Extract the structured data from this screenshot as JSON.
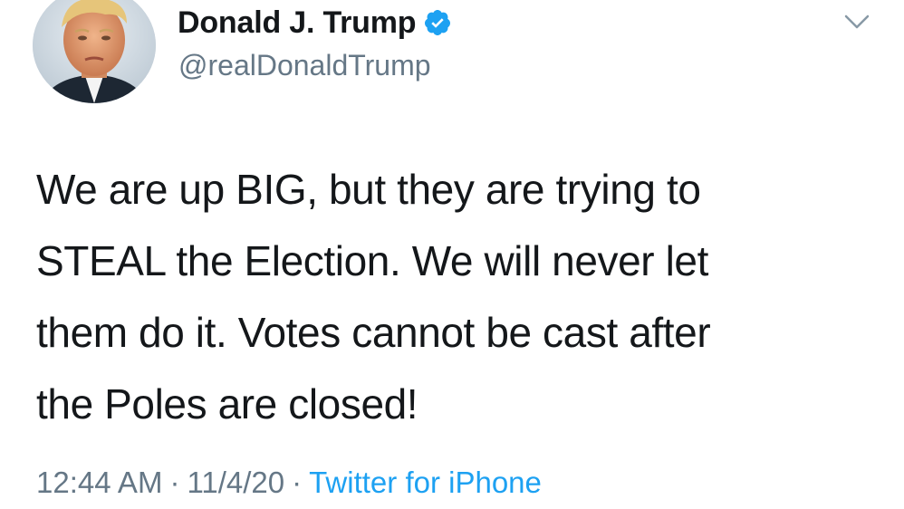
{
  "tweet": {
    "author": {
      "display_name": "Donald J. Trump",
      "handle": "@realDonaldTrump",
      "verified_icon": "verified-badge-icon",
      "avatar_icon": "profile-photo"
    },
    "menu_icon": "chevron-down-icon",
    "text_lines": [
      "We are up BIG, but they are trying to",
      "STEAL the Election. We will never let",
      "them do it. Votes cannot be cast after",
      "the Poles are closed!"
    ],
    "time": "12:44 AM",
    "separator": "·",
    "date": "11/4/20",
    "source": "Twitter for iPhone"
  },
  "colors": {
    "text": "#14171a",
    "secondary_text": "#657786",
    "accent": "#1da1f2",
    "background": "#ffffff"
  }
}
